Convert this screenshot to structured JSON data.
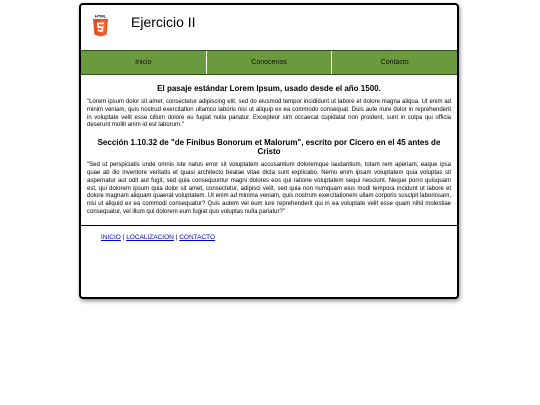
{
  "header": {
    "logo_text": "HTML",
    "title": "Ejercicio II"
  },
  "nav": {
    "items": [
      "Inicio",
      "Conocenos",
      "Contacto"
    ]
  },
  "content": {
    "heading1": "El pasaje estándar Lorem Ipsum, usado desde el año 1500.",
    "paragraph1": "\"Lorem ipsum dolor sit amet, consectetur adipiscing elit, sed do eiusmod tempor incididunt ut labore et dolore magna aliqua. Ut enim ad minim veniam, quis nostrud exercitation ullamco laboris nisi ut aliquip ex ea commodo consequat. Duis aute irure dolor in reprehenderit in voluptate velit esse cillum dolore eu fugiat nulla pariatur. Excepteur sint occaecat cupidatat non proident, sunt in culpa qui officia deserunt mollit anim id est laborum.\"",
    "heading2": "Sección 1.10.32 de \"de Finibus Bonorum et Malorum\", escrito por Cicero en el 45 antes de Cristo",
    "paragraph2": "\"Sed ut perspiciatis unde omnis iste natus error sit voluptatem accusantium doloremque laudantium, totam rem aperiam, eaque ipsa quae ab illo inventore veritatis et quasi architecto beatae vitae dicta sunt explicabo. Nemo enim ipsam voluptatem quia voluptas sit aspernatur aut odit aut fugit, sed quia consequuntur magni dolores eos qui ratione voluptatem sequi nesciunt. Neque porro quisquam est, qui dolorem ipsum quia dolor sit amet, consectetur, adipisci velit, sed quia non numquam eius modi tempora incidunt ut labore et dolore magnam aliquam quaerat voluptatem. Ut enim ad minima veniam, quis nostrum exercitationem ullam corporis suscipit laboriosam, nisi ut aliquid ex ea commodi consequatur? Quis autem vel eum iure reprehenderit qui in ea voluptate velit esse quam nihil molestiae consequatur, vel illum qui dolorem eum fugiat quo voluptas nulla pariatur?\""
  },
  "footer": {
    "links": [
      "INICIO",
      "LOCALIZACION",
      "CONTACTO"
    ],
    "separator": " | "
  },
  "colors": {
    "nav_background": "#6b9a3c",
    "logo_orange": "#e44d26",
    "link": "#0000cc"
  },
  "icons": {
    "logo": "html5-logo-icon"
  }
}
